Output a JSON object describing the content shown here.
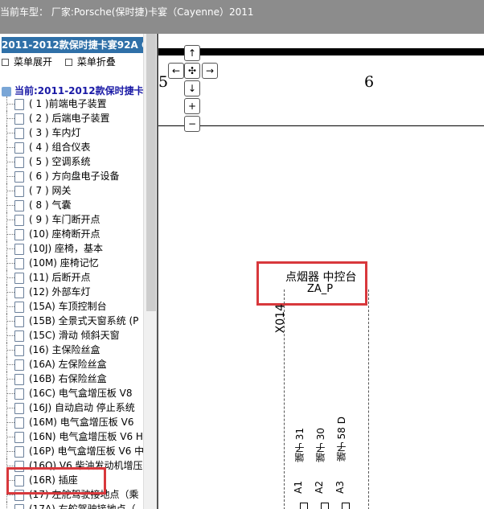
{
  "header": {
    "vehicle_text": "当前车型： 厂家:Porsche(保时捷)卡宴（Cayenne）2011"
  },
  "sidebar": {
    "title": "2011-2012款保时捷卡宴92A C",
    "expand_label": "菜单展开",
    "collapse_label": "菜单折叠",
    "current_label": "当前:2011-2012款保时捷卡",
    "items": [
      {
        "label": "( 1 )前端电子装置"
      },
      {
        "label": "( 2 ) 后端电子装置"
      },
      {
        "label": "( 3 ) 车内灯"
      },
      {
        "label": "( 4 ) 组合仪表"
      },
      {
        "label": "( 5 ) 空调系统"
      },
      {
        "label": "( 6 ) 方向盘电子设备"
      },
      {
        "label": "( 7 ) 网关"
      },
      {
        "label": "( 8 ) 气囊"
      },
      {
        "label": "( 9 ) 车门断开点"
      },
      {
        "label": "(10) 座椅断开点"
      },
      {
        "label": "(10J) 座椅，基本"
      },
      {
        "label": "(10M) 座椅记忆"
      },
      {
        "label": "(11) 后断开点"
      },
      {
        "label": "(12) 外部车灯"
      },
      {
        "label": "(15A) 车顶控制台"
      },
      {
        "label": "(15B) 全景式天窗系统 (P"
      },
      {
        "label": "(15C) 滑动 倾斜天窗"
      },
      {
        "label": "(16) 主保险丝盒"
      },
      {
        "label": "(16A) 左保险丝盒"
      },
      {
        "label": "(16B) 右保险丝盒"
      },
      {
        "label": "(16C) 电气盒增压板 V8"
      },
      {
        "label": "(16J) 自动启动 停止系统"
      },
      {
        "label": "(16M) 电气盒增压板 V6"
      },
      {
        "label": "(16N) 电气盒增压板 V6 H"
      },
      {
        "label": "(16P) 电气盒增压板 V6 中"
      },
      {
        "label": "(16Q) V6 柴油发动机增压"
      },
      {
        "label": "(16R) 插座"
      },
      {
        "label": "(17) 左舵驾驶接地点（乘"
      },
      {
        "label": "(17A) 右舵驾驶接地点（"
      }
    ]
  },
  "diagram": {
    "column_left": "5",
    "column_number": "6",
    "component_label": "点烟器 中控台",
    "component_code": "ZA_P",
    "connector_id": "X014",
    "terminals": [
      {
        "label": "端子 31",
        "pin": "A1"
      },
      {
        "label": "端子 30",
        "pin": "A2"
      },
      {
        "label": "端子 58 D",
        "pin": "A3"
      }
    ]
  },
  "nav": {
    "up": "↑",
    "left": "←",
    "center": "✣",
    "right": "→",
    "down": "↓",
    "zoom_in": "+",
    "zoom_out": "−"
  },
  "colors": {
    "highlight": "#d8383c",
    "title_bg": "#2f70a8",
    "header_bg": "#8c8c8c"
  }
}
